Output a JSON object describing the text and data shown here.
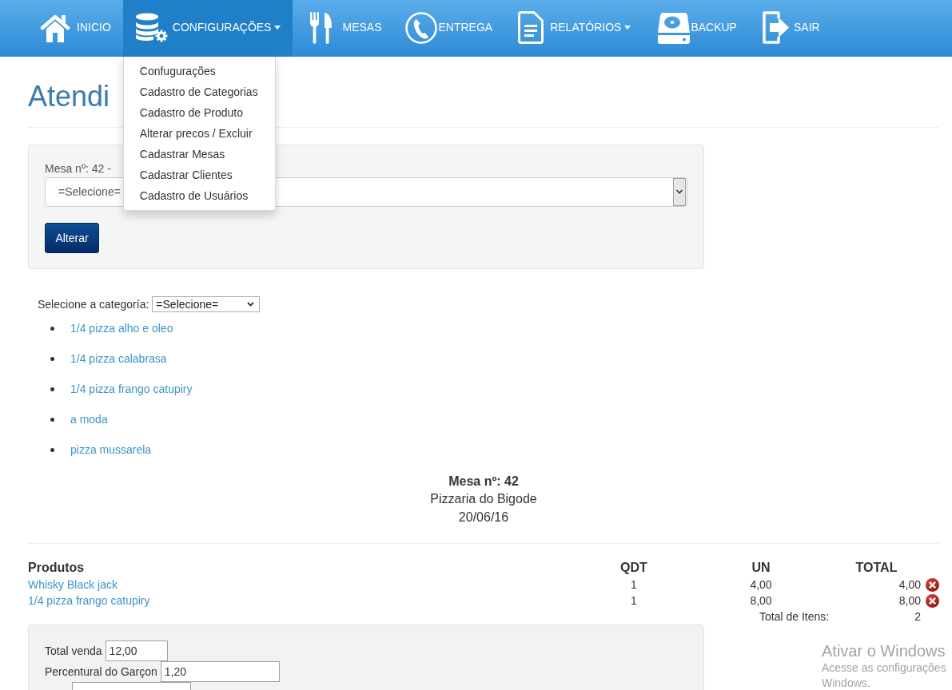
{
  "navbar": {
    "items": [
      {
        "kind": "home",
        "label": "INICIO",
        "selected": false,
        "caret": false
      },
      {
        "kind": "settings",
        "label": "CONFIGURAÇÕES",
        "selected": true,
        "caret": true,
        "menu": [
          "Confugurações",
          "Cadastro de Categorias",
          "Cadastro de Produto",
          "Alterar precos / Excluir",
          "Cadastrar Mesas",
          "Cadastrar Clientes",
          "Cadastro de Usuários"
        ]
      },
      {
        "kind": "tables",
        "label": "MESAS",
        "selected": false,
        "caret": false
      },
      {
        "kind": "delivery",
        "label": "ENTREGA",
        "selected": false,
        "caret": false
      },
      {
        "kind": "reports",
        "label": "RELATÓRIOS",
        "selected": false,
        "caret": true
      },
      {
        "kind": "backup",
        "label": "BACKUP",
        "selected": false,
        "caret": false
      },
      {
        "kind": "logout",
        "label": "SAIR",
        "selected": false,
        "caret": false
      }
    ]
  },
  "page_title": "Atendi",
  "table_form": {
    "label": "Mesa nº: 42 -",
    "select": {
      "value": "=Selecione="
    },
    "button": "Alterar"
  },
  "category_filter": {
    "label": "Selecione a categoría:",
    "select": {
      "value": "=Selecione="
    }
  },
  "categories": [
    "1/4 pizza alho e oleo",
    "1/4 pizza calabrasa",
    "1/4 pizza frango catupiry",
    "a moda",
    "pizza mussarela"
  ],
  "receipt_header": {
    "title": "Mesa nº: 42",
    "name": "Pizzaria do Bigode",
    "date": "20/06/16"
  },
  "order_table": {
    "columns": [
      "Produtos",
      "QDT",
      "UN",
      "TOTAL"
    ],
    "rows": [
      {
        "product": "Whisky Black jack",
        "qty": "1",
        "unit": "4,00",
        "total": "4,00"
      },
      {
        "product": "1/4 pizza frango catupiry",
        "qty": "1",
        "unit": "8,00",
        "total": "8,00"
      }
    ],
    "summary": {
      "label": "Total de Itens:",
      "value": "2"
    }
  },
  "totals_form": {
    "fields": [
      {
        "label": "Total venda",
        "value": "12,00"
      },
      {
        "label": "Percentural do Garçon",
        "value": "1,20"
      }
    ]
  },
  "activation_notice": {
    "title": "Ativar o Windows",
    "lines": [
      "Acesse as configurações",
      "Windows."
    ]
  }
}
